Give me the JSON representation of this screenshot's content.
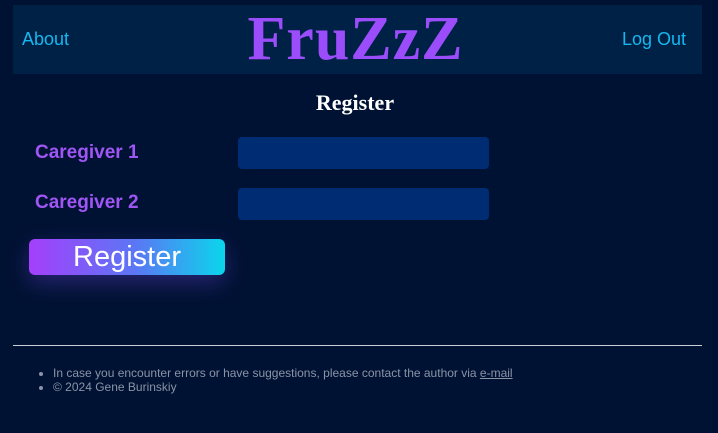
{
  "header": {
    "about_label": "About",
    "brand": "FruZzZ",
    "logout_label": "Log Out"
  },
  "page": {
    "title": "Register"
  },
  "form": {
    "caregiver1_label": "Caregiver 1",
    "caregiver1_value": "",
    "caregiver2_label": "Caregiver 2",
    "caregiver2_value": "",
    "submit_label": "Register"
  },
  "footer": {
    "contact_text": "In case you encounter errors or have suggestions, please contact the author via ",
    "contact_link_label": "e-mail",
    "copyright": "© 2024 Gene Burinskiy"
  },
  "colors": {
    "background": "#001233",
    "header_background": "#002146",
    "brand": "#9b4dfb",
    "nav_link": "#14b8f0",
    "label": "#a055f5",
    "input_background": "#002c73",
    "button_gradient_start": "#a43ffb",
    "button_gradient_end": "#0ad6ec",
    "footer_text": "#8a93a6"
  }
}
